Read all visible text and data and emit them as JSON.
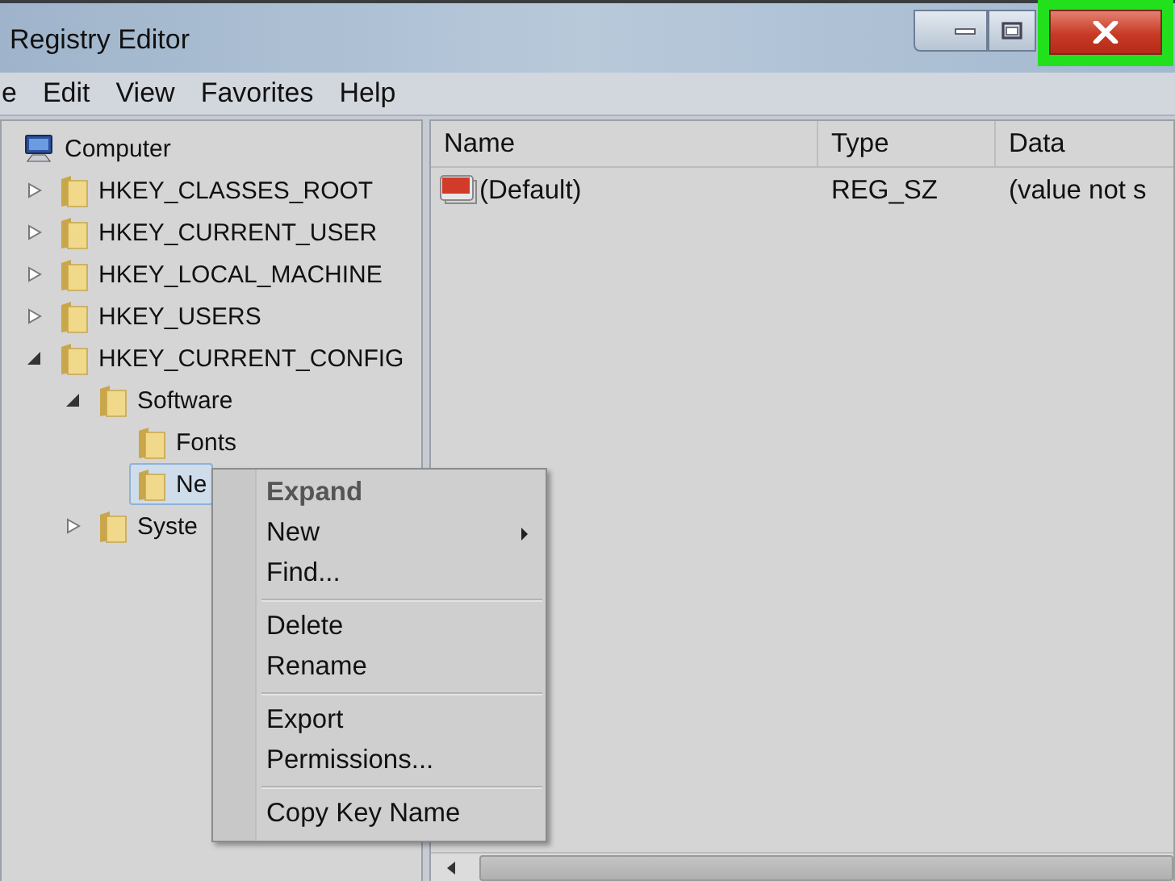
{
  "window": {
    "title": "Registry Editor",
    "controls": [
      {
        "kind": "minimize"
      },
      {
        "kind": "maximize"
      },
      {
        "kind": "close",
        "highlighted": true
      }
    ]
  },
  "menu_bar": [
    "e",
    "Edit",
    "View",
    "Favorites",
    "Help"
  ],
  "tree": {
    "label": "Computer",
    "kind": "computer",
    "selected": false,
    "children": [
      {
        "label": "HKEY_CLASSES_ROOT",
        "kind": "folder",
        "expanded": false,
        "selected": false
      },
      {
        "label": "HKEY_CURRENT_USER",
        "kind": "folder",
        "expanded": false,
        "selected": false
      },
      {
        "label": "HKEY_LOCAL_MACHINE",
        "kind": "folder",
        "expanded": false,
        "selected": false
      },
      {
        "label": "HKEY_USERS",
        "kind": "folder",
        "expanded": false,
        "selected": false
      },
      {
        "label": "HKEY_CURRENT_CONFIG",
        "kind": "folder",
        "expanded": true,
        "selected": false,
        "children": [
          {
            "label": "Software",
            "kind": "folder",
            "expanded": true,
            "selected": false,
            "children": [
              {
                "label": "Fonts",
                "kind": "folder",
                "selected": false
              },
              {
                "label": "Ne",
                "kind": "folder",
                "selected": true
              }
            ]
          },
          {
            "label": "Syste",
            "kind": "folder",
            "expanded": false,
            "selected": false
          }
        ]
      }
    ]
  },
  "list": {
    "columns": [
      "Name",
      "Type",
      "Data"
    ],
    "rows": [
      {
        "name": "(Default)",
        "type": "REG_SZ",
        "data": "(value not s"
      }
    ]
  },
  "context_menu": [
    {
      "kind": "item",
      "label": "Expand",
      "default": true,
      "submenu": false
    },
    {
      "kind": "item",
      "label": "New",
      "default": false,
      "submenu": true
    },
    {
      "kind": "item",
      "label": "Find...",
      "default": false,
      "submenu": false
    },
    {
      "kind": "separator"
    },
    {
      "kind": "item",
      "label": "Delete",
      "default": false,
      "submenu": false
    },
    {
      "kind": "item",
      "label": "Rename",
      "default": false,
      "submenu": false
    },
    {
      "kind": "separator"
    },
    {
      "kind": "item",
      "label": "Export",
      "default": false,
      "submenu": false
    },
    {
      "kind": "item",
      "label": "Permissions...",
      "default": false,
      "submenu": false
    },
    {
      "kind": "separator"
    },
    {
      "kind": "item",
      "label": "Copy Key Name",
      "default": false,
      "submenu": false
    }
  ]
}
